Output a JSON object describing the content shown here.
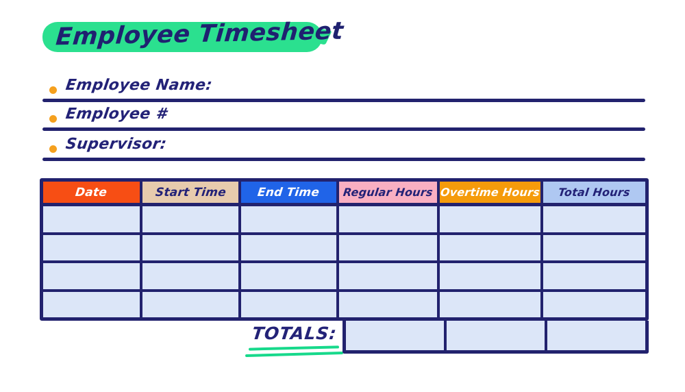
{
  "document": {
    "title": "Employee Timesheet"
  },
  "colors": {
    "ink": "#22226E",
    "highlight_green": "#2BE08F",
    "bullet_orange": "#F5A01E",
    "cell_fill": "#DCE6F8",
    "dot_pattern": "#DCE7F9",
    "header_date_bg": "#F74E14",
    "header_start_bg": "#E7CBAD",
    "header_end_bg": "#2064E8",
    "header_regular_bg": "#F9AFC2",
    "header_overtime_bg": "#F59B0B",
    "header_total_bg": "#AFC8F2"
  },
  "fields": [
    {
      "label": "Employee Name:",
      "value": ""
    },
    {
      "label": "Employee #",
      "value": ""
    },
    {
      "label": "Supervisor:",
      "value": ""
    }
  ],
  "table": {
    "columns": [
      {
        "label": "Date",
        "style": "hdr-date"
      },
      {
        "label": "Start Time",
        "style": "hdr-start"
      },
      {
        "label": "End Time",
        "style": "hdr-end"
      },
      {
        "label": "Regular Hours",
        "style": "hdr-regular"
      },
      {
        "label": "Overtime Hours",
        "style": "hdr-overtime"
      },
      {
        "label": "Total Hours",
        "style": "hdr-total"
      }
    ],
    "rows": [
      [
        "",
        "",
        "",
        "",
        "",
        ""
      ],
      [
        "",
        "",
        "",
        "",
        "",
        ""
      ],
      [
        "",
        "",
        "",
        "",
        "",
        ""
      ],
      [
        "",
        "",
        "",
        "",
        "",
        ""
      ]
    ]
  },
  "totals": {
    "label": "TOTALS:",
    "regular_hours": "",
    "overtime_hours": "",
    "total_hours": ""
  }
}
